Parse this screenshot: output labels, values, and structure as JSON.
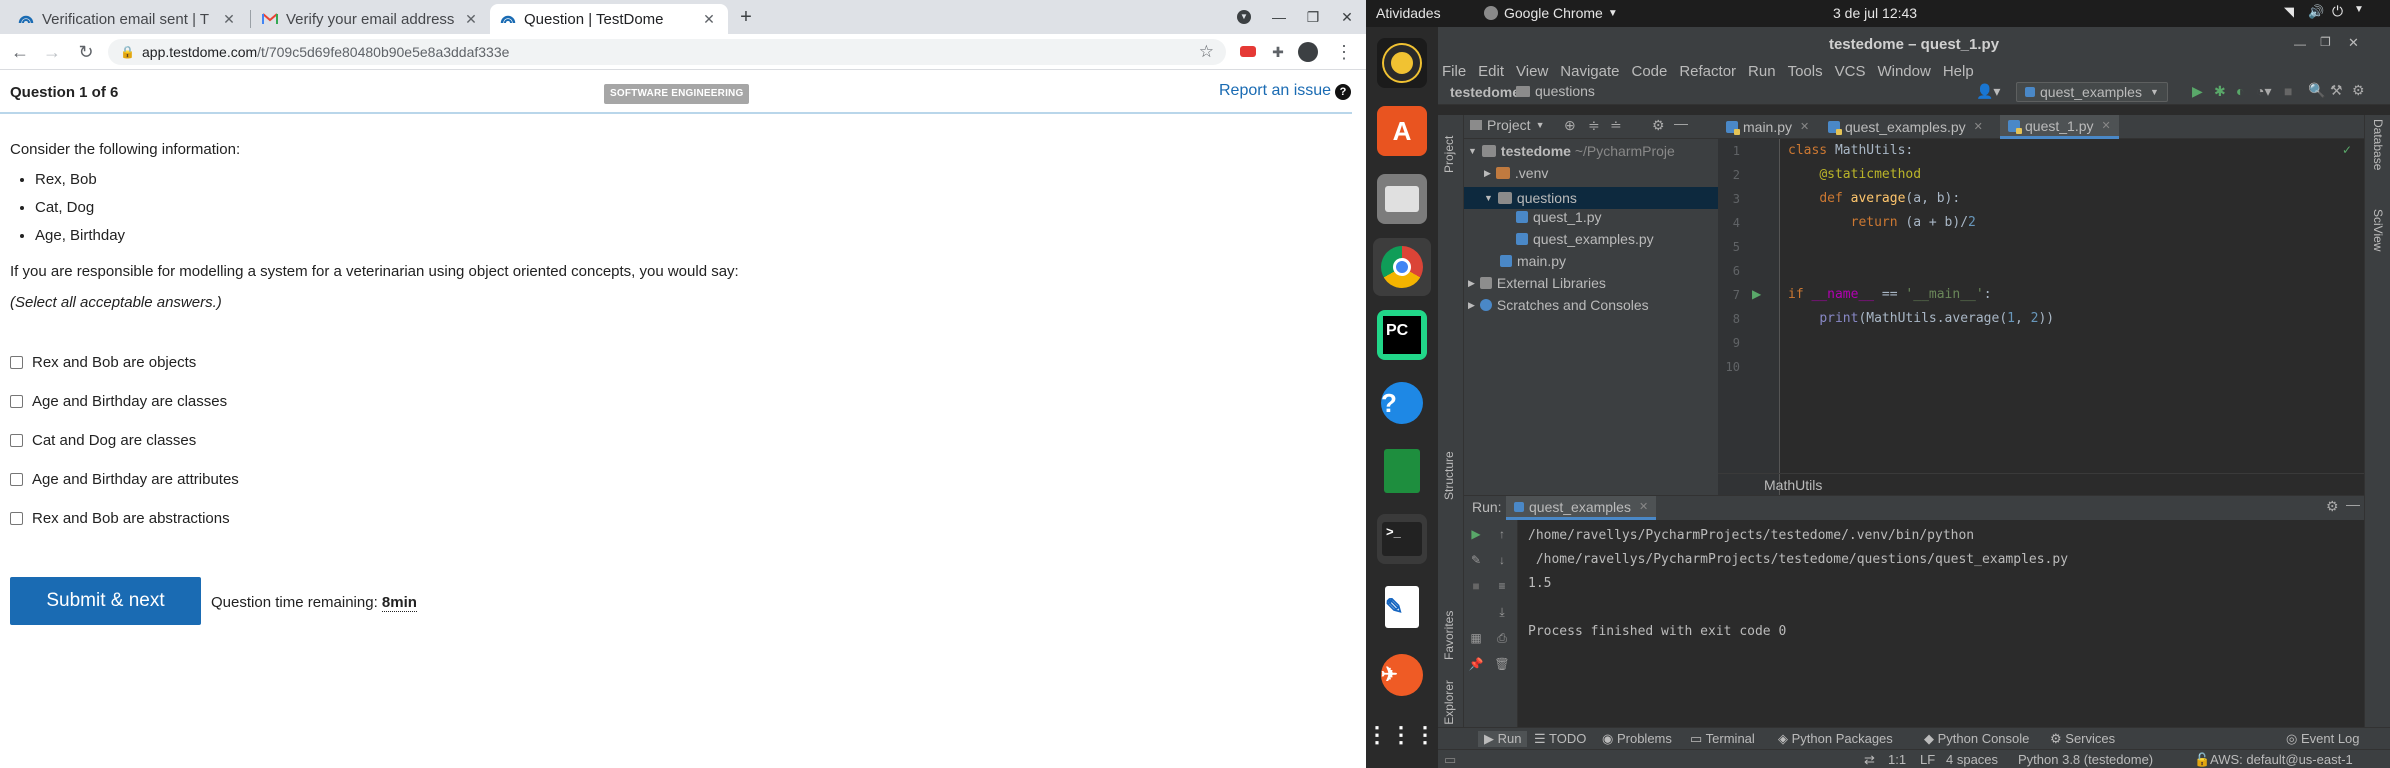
{
  "chrome": {
    "tabs": [
      {
        "title": "Verification email sent | T",
        "favicon": "testdome-icon"
      },
      {
        "title": "Verify your email address",
        "favicon": "gmail-icon"
      },
      {
        "title": "Question | TestDome",
        "favicon": "testdome-icon"
      }
    ],
    "url_host": "app.testdome.com",
    "url_path": "/t/709c5d69fe80480b90e5e8a3ddaf333e"
  },
  "quiz": {
    "counter": "Question 1 of 6",
    "category": "SOFTWARE ENGINEERING",
    "report_link": "Report an issue",
    "help_glyph": "?",
    "intro": "Consider the following information:",
    "info_items": [
      "Rex, Bob",
      "Cat, Dog",
      "Age, Birthday"
    ],
    "question": "If you are responsible for modelling a system for a veterinarian using object oriented concepts, you would say:",
    "instruction": "(Select all acceptable answers.)",
    "options": [
      "Rex and Bob are objects",
      "Age and Birthday are classes",
      "Cat and Dog are classes",
      "Age and Birthday are attributes",
      "Rex and Bob are abstractions"
    ],
    "submit_label": "Submit & next",
    "timer_label": "Question time remaining:",
    "timer_value": "8min"
  },
  "ubuntu": {
    "activities": "Atividades",
    "app_menu": "Google Chrome",
    "clock": "3 de jul  12:43"
  },
  "pycharm": {
    "title": "testedome – quest_1.py",
    "menu": [
      "File",
      "Edit",
      "View",
      "Navigate",
      "Code",
      "Refactor",
      "Run",
      "Tools",
      "VCS",
      "Window",
      "Help"
    ],
    "nav_project": "testedome",
    "nav_folder": "questions",
    "run_config": "quest_examples",
    "project_label": "Project",
    "tree": {
      "root": "testedome",
      "root_path": "~/PycharmProje",
      "venv": ".venv",
      "questions": "questions",
      "file1": "quest_1.py",
      "file2": "quest_examples.py",
      "main": "main.py",
      "ext_libs": "External Libraries",
      "scratches": "Scratches and Consoles"
    },
    "editor_tabs": [
      "main.py",
      "quest_examples.py",
      "quest_1.py"
    ],
    "code_breadcrumb": "MathUtils",
    "line_numbers": [
      "1",
      "2",
      "3",
      "4",
      "5",
      "6",
      "7",
      "8",
      "9",
      "10"
    ],
    "run": {
      "label": "Run:",
      "tab": "quest_examples",
      "output": [
        "/home/ravellys/PycharmProjects/testedome/.venv/bin/python",
        " /home/ravellys/PycharmProjects/testedome/questions/quest_examples.py",
        "1.5",
        "",
        "Process finished with exit code 0"
      ]
    },
    "bottom_tabs": [
      "Run",
      "TODO",
      "Problems",
      "Terminal",
      "Python Packages",
      "Python Console",
      "Services"
    ],
    "event_log": "Event Log",
    "status": {
      "position": "1:1",
      "line_sep": "LF",
      "indent": "4 spaces",
      "interpreter": "Python 3.8 (testedome)",
      "aws": "AWS: default@us-east-1"
    },
    "left_strip": [
      "Project",
      "Structure",
      "Favorites",
      "AWS Explorer"
    ],
    "right_strip": [
      "Database",
      "SciView"
    ]
  }
}
